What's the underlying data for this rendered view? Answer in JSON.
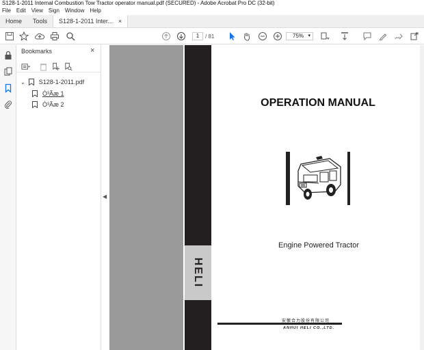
{
  "window": {
    "title": "S128-1-2011 Internal Combustion Tow Tractor operator manual.pdf (SECURED) - Adobe Acrobat Pro DC (32-bit)"
  },
  "menu": [
    "File",
    "Edit",
    "View",
    "Sign",
    "Window",
    "Help"
  ],
  "tabs": {
    "home": "Home",
    "tools": "Tools",
    "document": "S128-1-2011 Inter...",
    "close": "×"
  },
  "toolbar": {
    "page_current": "1",
    "page_total": "/ 81",
    "zoom": "75%"
  },
  "bookmarks": {
    "title": "Bookmarks",
    "close": "×",
    "root": "S128-1-2011.pdf",
    "items": [
      "Ò³Ãæ 1",
      "Ò³Ãæ 2"
    ]
  },
  "document": {
    "heading": "OPERATION MANUAL",
    "subtitle": "Engine Powered Tractor",
    "side_logo": "HELI",
    "company_cn": "安徽合力股份有限公司",
    "company_en": "ANHUI HELI CO.,LTD."
  },
  "colors": {
    "panel_gray": "#9a9a9a",
    "cover_black": "#231f20",
    "accent_blue": "#1473e6"
  }
}
